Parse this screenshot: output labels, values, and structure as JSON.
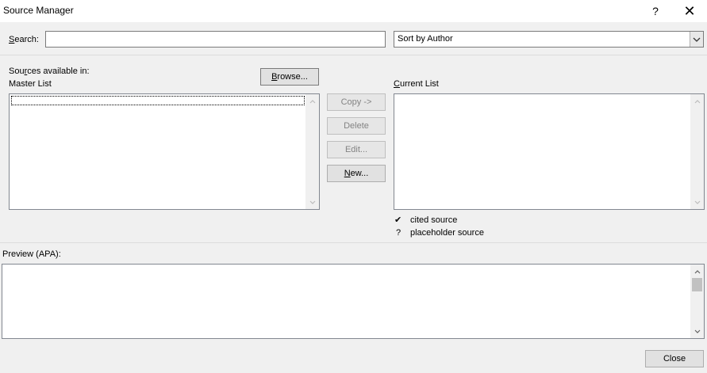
{
  "window": {
    "title": "Source Manager",
    "help_glyph": "?",
    "close_glyph": "✕"
  },
  "search": {
    "label_pre": "",
    "label_u": "S",
    "label_post": "earch:",
    "value": "",
    "placeholder": ""
  },
  "sort": {
    "selected": "Sort by Author"
  },
  "master": {
    "available_pre": "Sou",
    "available_u": "r",
    "available_post": "ces available in:",
    "list_label": "Master List",
    "browse_u": "B",
    "browse_post": "rowse..."
  },
  "actions": {
    "copy": "Copy ->",
    "delete": "Delete",
    "edit": "Edit...",
    "new_u": "N",
    "new_post": "ew..."
  },
  "current": {
    "label_u": "C",
    "label_post": "urrent List"
  },
  "legend": {
    "cited_symbol": "✔",
    "cited_text": "cited source",
    "placeholder_symbol": "?",
    "placeholder_text": "placeholder source"
  },
  "preview": {
    "label": "Preview (APA):"
  },
  "footer": {
    "close": "Close"
  }
}
